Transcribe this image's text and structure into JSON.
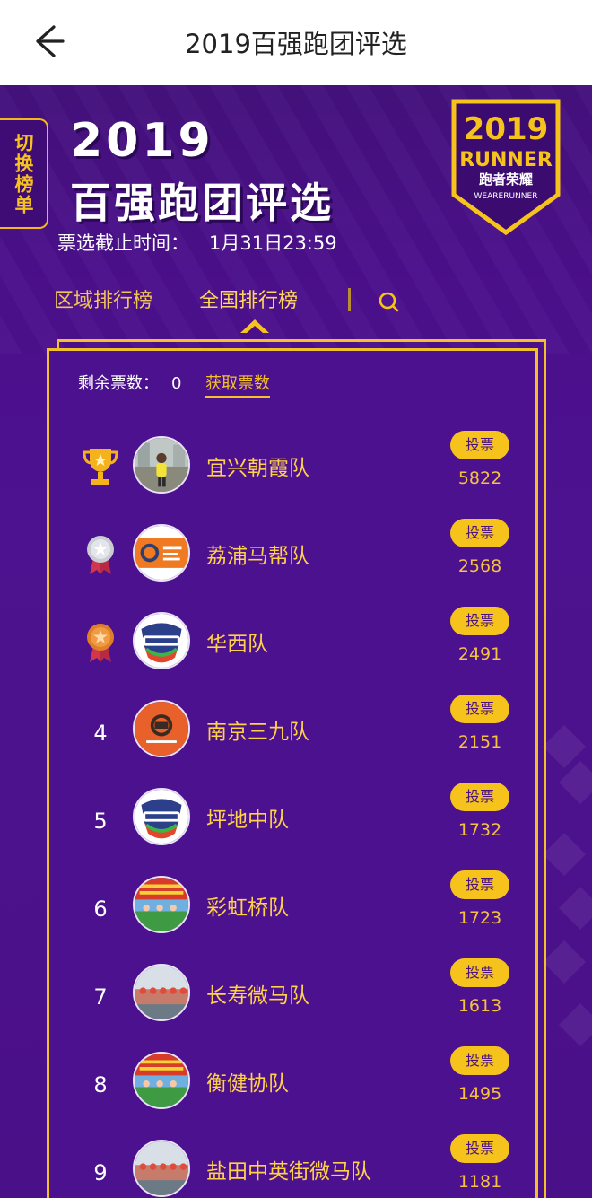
{
  "app": {
    "title": "2019百强跑团评选"
  },
  "hero": {
    "switch_label": "切换榜单",
    "year": "2019",
    "headline": "百强跑团评选",
    "deadline_label": "票选截止时间：",
    "deadline_value": "1月31日23:59",
    "badge": {
      "top": "2019",
      "brand": "RUNNER",
      "cn": "跑者荣耀",
      "en": "WEARERUNNER"
    }
  },
  "tabs": [
    {
      "label": "区域排行榜",
      "active": false
    },
    {
      "label": "全国排行榜",
      "active": true
    }
  ],
  "panel": {
    "remain_label": "剩余票数：",
    "remain_value": "0",
    "get_votes_label": "获取票数",
    "vote_label": "投票"
  },
  "teams": [
    {
      "rank": "1",
      "medal": "gold-trophy",
      "name": "宜兴朝霞队",
      "votes": "5822",
      "avatar": "photo-runner"
    },
    {
      "rank": "2",
      "medal": "silver-medal",
      "name": "荔浦马帮队",
      "votes": "2568",
      "avatar": "orange-logo"
    },
    {
      "rank": "3",
      "medal": "bronze-medal",
      "name": "华西队",
      "votes": "2491",
      "avatar": "micro-marathon-logo"
    },
    {
      "rank": "4",
      "medal": "",
      "name": "南京三九队",
      "votes": "2151",
      "avatar": "orange-round-logo"
    },
    {
      "rank": "5",
      "medal": "",
      "name": "坪地中队",
      "votes": "1732",
      "avatar": "micro-marathon-logo"
    },
    {
      "rank": "6",
      "medal": "",
      "name": "彩虹桥队",
      "votes": "1723",
      "avatar": "group-photo-banner"
    },
    {
      "rank": "7",
      "medal": "",
      "name": "长寿微马队",
      "votes": "1613",
      "avatar": "group-photo"
    },
    {
      "rank": "8",
      "medal": "",
      "name": "衡健协队",
      "votes": "1495",
      "avatar": "group-photo-banner"
    },
    {
      "rank": "9",
      "medal": "",
      "name": "盐田中英街微马队",
      "votes": "1181",
      "avatar": "group-photo"
    }
  ],
  "colors": {
    "purple": "#4c118e",
    "gold": "#f6c21c",
    "text_gold": "#ffd04a"
  }
}
